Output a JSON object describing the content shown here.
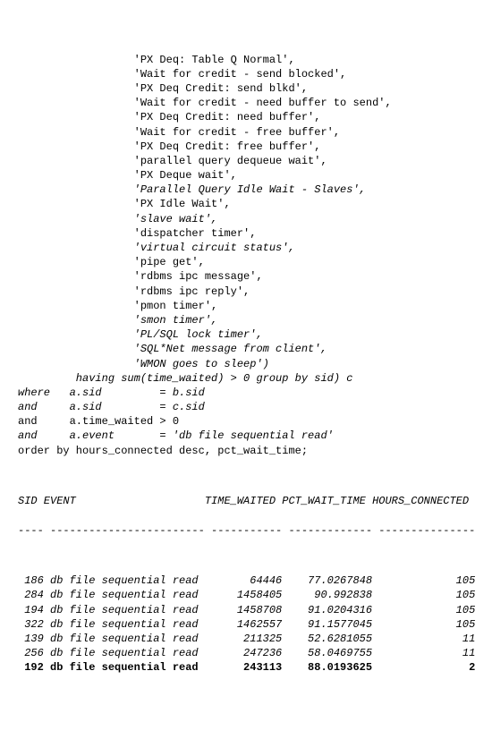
{
  "code_lines": [
    {
      "text": "                  'PX Deq: Table Q Normal',"
    },
    {
      "text": "                  'Wait for credit - send blocked',"
    },
    {
      "text": "                  'PX Deq Credit: send blkd',"
    },
    {
      "text": "                  'Wait for credit - need buffer to send',"
    },
    {
      "text": "                  'PX Deq Credit: need buffer',"
    },
    {
      "text": "                  'Wait for credit - free buffer',"
    },
    {
      "text": "                  'PX Deq Credit: free buffer',"
    },
    {
      "text": "                  'parallel query dequeue wait',"
    },
    {
      "text": "                  'PX Deque wait',"
    },
    {
      "text": "                  'Parallel Query Idle Wait - Slaves',",
      "italic": true
    },
    {
      "text": "                  'PX Idle Wait',"
    },
    {
      "text": "                  'slave wait',",
      "italic": true
    },
    {
      "text": "                  'dispatcher timer',"
    },
    {
      "text": "                  'virtual circuit status',",
      "italic": true
    },
    {
      "text": "                  'pipe get',"
    },
    {
      "text": "                  'rdbms ipc message',"
    },
    {
      "text": "                  'rdbms ipc reply',"
    },
    {
      "text": "                  'pmon timer',"
    },
    {
      "text": "                  'smon timer',",
      "italic": true
    },
    {
      "text": "                  'PL/SQL lock timer',",
      "italic": true
    },
    {
      "text": "                  'SQL*Net message from client',",
      "italic": true
    },
    {
      "text": "                  'WMON goes to sleep')",
      "italic": true
    },
    {
      "text": "         having sum(time_waited) > 0 group by sid) c",
      "italic": true
    },
    {
      "text": "where   a.sid         = b.sid",
      "italic": true
    },
    {
      "text": "and     a.sid         = c.sid",
      "italic": true
    },
    {
      "text": "and     a.time_waited > 0"
    },
    {
      "text": "and     a.event       = 'db file sequential read'",
      "italic": true
    },
    {
      "text": "order by hours_connected desc, pct_wait_time;"
    }
  ],
  "report": {
    "header": "SID EVENT                    TIME_WAITED PCT_WAIT_TIME HOURS_CONNECTED",
    "divider": "---- ------------------------ ----------- ------------- ---------------",
    "rows": [
      {
        "sid": "186",
        "event": "db file sequential read",
        "time_waited": "64446",
        "pct": "77.0267848",
        "hours": "105",
        "italic": true
      },
      {
        "sid": "284",
        "event": "db file sequential read",
        "time_waited": "1458405",
        "pct": "90.992838",
        "hours": "105",
        "italic": true
      },
      {
        "sid": "194",
        "event": "db file sequential read",
        "time_waited": "1458708",
        "pct": "91.0204316",
        "hours": "105",
        "italic": true
      },
      {
        "sid": "322",
        "event": "db file sequential read",
        "time_waited": "1462557",
        "pct": "91.1577045",
        "hours": "105",
        "italic": true
      },
      {
        "sid": "139",
        "event": "db file sequential read",
        "time_waited": "211325",
        "pct": "52.6281055",
        "hours": "11",
        "italic": true
      },
      {
        "sid": "256",
        "event": "db file sequential read",
        "time_waited": "247236",
        "pct": "58.0469755",
        "hours": "11",
        "italic": true
      },
      {
        "sid": "192",
        "event": "db file sequential read",
        "time_waited": "243113",
        "pct": "88.0193625",
        "hours": "2",
        "bold": true
      }
    ]
  }
}
